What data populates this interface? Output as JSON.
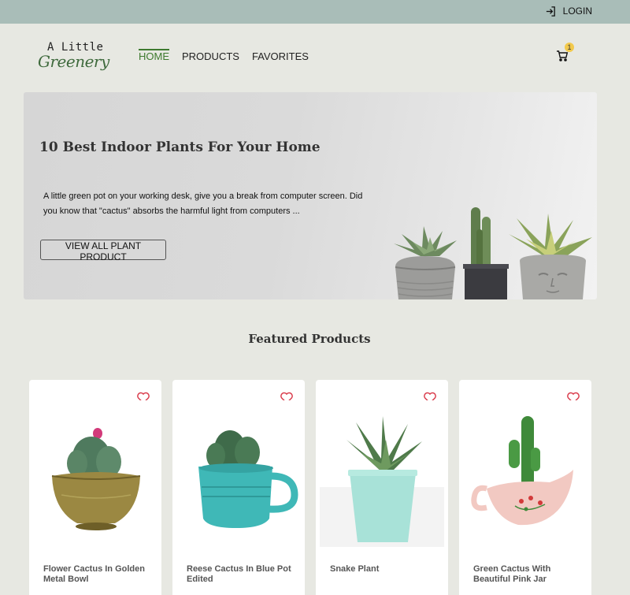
{
  "topbar": {
    "login_label": "LOGIN",
    "login_icon": "login-icon"
  },
  "header": {
    "logo_line1": "A Little",
    "logo_line2": "Greenery",
    "nav": [
      {
        "label": "HOME",
        "active": true
      },
      {
        "label": "PRODUCTS",
        "active": false
      },
      {
        "label": "FAVORITES",
        "active": false
      }
    ],
    "cart_count": "1"
  },
  "hero": {
    "title": "10 Best Indoor Plants For Your Home",
    "description": "A little green pot on your working desk, give you a break from computer screen. Did you know that \"cactus\" absorbs the harmful light from computers ...",
    "button_label": "VIEW ALL PLANT PRODUCT"
  },
  "featured": {
    "heading": "Featured Products",
    "products": [
      {
        "name": "Flower Cactus In Golden Metal Bowl"
      },
      {
        "name": "Reese Cactus In Blue Pot Edited"
      },
      {
        "name": "Snake Plant"
      },
      {
        "name": "Green Cactus With Beautiful Pink Jar"
      }
    ]
  },
  "colors": {
    "topbar": "#a9bdb8",
    "background": "#e7e8e2",
    "accent": "#3e7a2f",
    "heart": "#d93a4a",
    "badge": "#f2c94c"
  }
}
